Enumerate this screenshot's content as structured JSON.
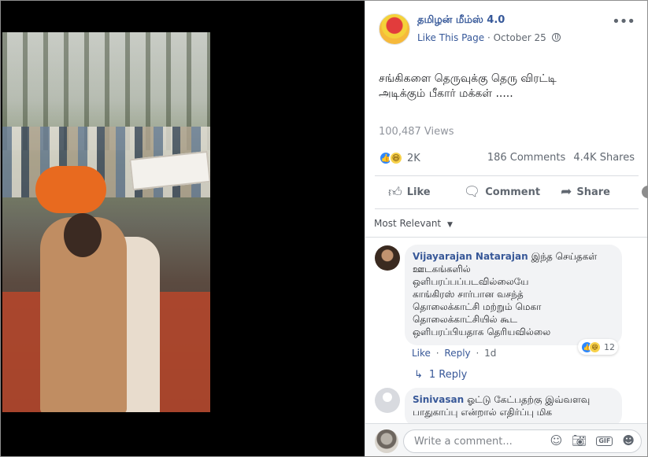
{
  "post": {
    "page_name": "தமிழன் மீம்ஸ் 4.0",
    "like_page": "Like This Page",
    "separator": "·",
    "date": "October 25",
    "privacy_icon": "globe-icon",
    "more_icon": "more-horizontal-icon",
    "text": "சங்கிகளை தெருவுக்கு தெரு விரட்டி\nஅடிக்கும் பீகார் மக்கள் .....",
    "views": "100,487 Views",
    "reaction_count": "2K",
    "comments_count": "186 Comments",
    "shares_count": "4.4K Shares"
  },
  "actions": {
    "like": "Like",
    "comment": "Comment",
    "share": "Share",
    "like_icon": "thumbs-up-icon",
    "comment_icon": "speech-bubble-icon",
    "share_icon": "share-arrow-icon"
  },
  "sort": {
    "label": "Most Relevant"
  },
  "comments": [
    {
      "author": "Vijayarajan Natarajan",
      "text": "இந்த செய்தகள்\nஊடகங்களில்\nஒளிபரப்பப்படவில்லையே\nகாங்கிரஸ் சார்பான வசந்த்\nதொலைக்காட்சி மற்றும் மெகா\nதொலைக்காட்சியில் கூட\nஒளிபரப்பியதாக தெரியவில்லை",
      "reaction_count": "12",
      "like": "Like",
      "reply": "Reply",
      "sep": "·",
      "time": "1d",
      "replies": "1 Reply"
    },
    {
      "author": "Sinivasan",
      "text": "ஓட்டு கேட்பதற்கு இவ்வளவு\nபாதுகாப்பு என்றால் எதிர்ப்பு மிக"
    }
  ],
  "composer": {
    "placeholder": "Write a comment...",
    "icons": [
      "emoji-icon",
      "camera-icon",
      "gif-icon",
      "sticker-icon"
    ],
    "gif_label": "GIF"
  },
  "colors": {
    "link": "#365899",
    "like_blue": "#2d88ff",
    "haha_yellow": "#f7d14a",
    "muted": "#606770"
  }
}
